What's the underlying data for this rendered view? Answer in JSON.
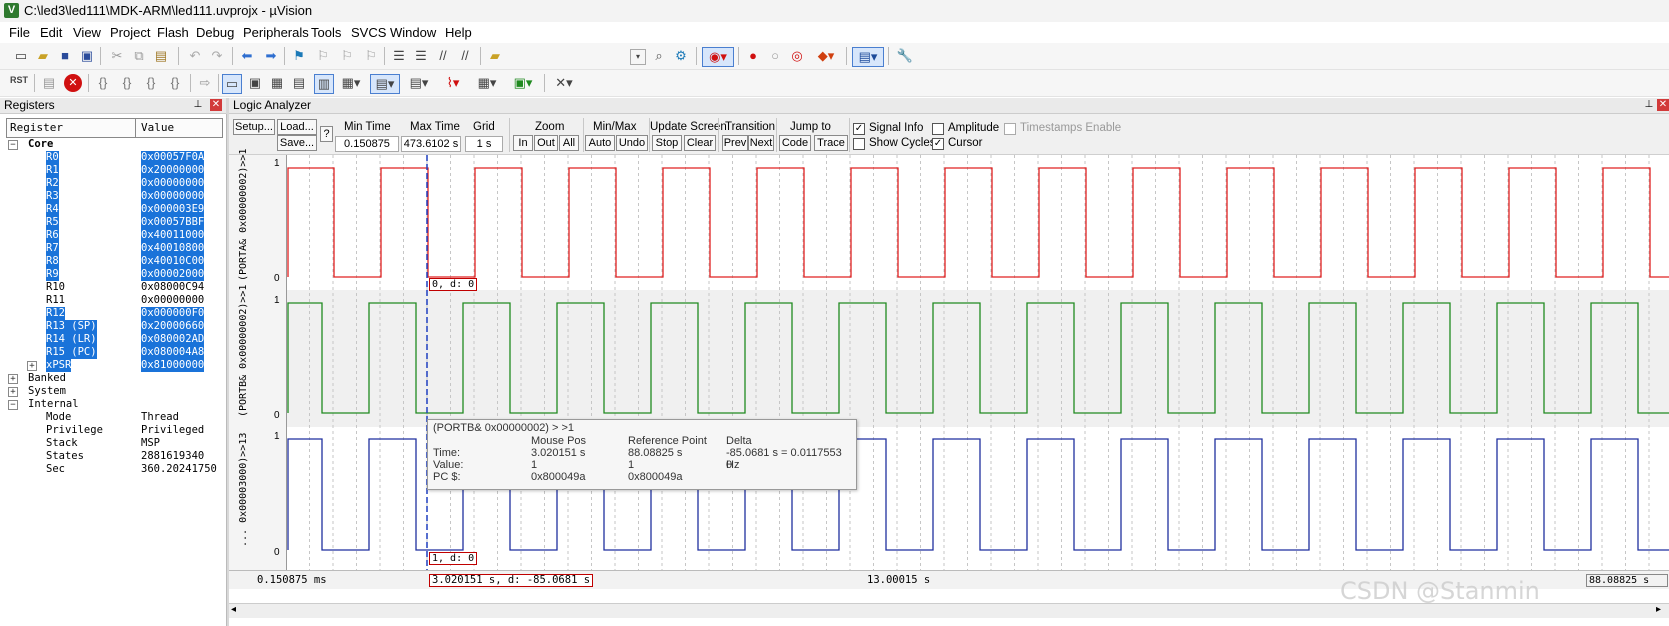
{
  "window": {
    "title": "C:\\led3\\led111\\MDK-ARM\\led111.uvprojx - µVision",
    "app_icon": "V"
  },
  "menu": [
    "File",
    "Edit",
    "View",
    "Project",
    "Flash",
    "Debug",
    "Peripherals",
    "Tools",
    "SVCS",
    "Window",
    "Help"
  ],
  "toolbar2_label": "RST",
  "registers": {
    "title": "Registers",
    "col_register": "Register",
    "col_value": "Value",
    "core_label": "Core",
    "core": [
      {
        "name": "R0",
        "value": "0x00057F0A"
      },
      {
        "name": "R1",
        "value": "0x20000000"
      },
      {
        "name": "R2",
        "value": "0x00000000"
      },
      {
        "name": "R3",
        "value": "0x00000000"
      },
      {
        "name": "R4",
        "value": "0x000003E9"
      },
      {
        "name": "R5",
        "value": "0x00057BBF"
      },
      {
        "name": "R6",
        "value": "0x40011000"
      },
      {
        "name": "R7",
        "value": "0x40010800"
      },
      {
        "name": "R8",
        "value": "0x40010C00"
      },
      {
        "name": "R9",
        "value": "0x00002000"
      },
      {
        "name": "R10",
        "value": "0x08000C94"
      },
      {
        "name": "R11",
        "value": "0x00000000"
      },
      {
        "name": "R12",
        "value": "0x000000F0"
      },
      {
        "name": "R13 (SP)",
        "value": "0x20000660"
      },
      {
        "name": "R14 (LR)",
        "value": "0x080002AD"
      },
      {
        "name": "R15 (PC)",
        "value": "0x080004A8"
      },
      {
        "name": "xPSR",
        "value": "0x81000000"
      }
    ],
    "groups": [
      "Banked",
      "System",
      "Internal"
    ],
    "internal": [
      {
        "name": "Mode",
        "value": "Thread"
      },
      {
        "name": "Privilege",
        "value": "Privileged"
      },
      {
        "name": "Stack",
        "value": "MSP"
      },
      {
        "name": "States",
        "value": "2881619340"
      },
      {
        "name": "Sec",
        "value": "360.20241750"
      }
    ]
  },
  "logic_analyzer": {
    "title": "Logic Analyzer",
    "setup": "Setup...",
    "load": "Load...",
    "save": "Save...",
    "help": "?",
    "min_time_label": "Min Time",
    "min_time": "0.150875 ms",
    "max_time_label": "Max Time",
    "max_time": "473.6102 s",
    "grid_label": "Grid",
    "grid": "1 s",
    "zoom_label": "Zoom",
    "zoom_in": "In",
    "zoom_out": "Out",
    "zoom_all": "All",
    "minmax_label": "Min/Max",
    "auto": "Auto",
    "undo": "Undo",
    "update_label": "Update Screen",
    "stop": "Stop",
    "clear": "Clear",
    "transition_label": "Transition",
    "prev": "Prev",
    "next": "Next",
    "jump_label": "Jump to",
    "code": "Code",
    "trace": "Trace",
    "signal_info": "Signal Info",
    "show_cycles": "Show Cycles",
    "amplitude": "Amplitude",
    "cursor": "Cursor",
    "timestamps": "Timestamps Enable",
    "options": {
      "signal_info": true,
      "show_cycles": false,
      "amplitude": false,
      "cursor": true,
      "timestamps": false
    },
    "signals": [
      {
        "name": "(PORTA& 0x00000002)>>1",
        "color": "#e02020",
        "cursor_label": "0,  d: 0"
      },
      {
        "name": "(PORTB& 0x00000002)>>1",
        "color": "#208a20",
        "cursor_label": ""
      },
      {
        "name": "... 0x00003000)>>13",
        "color": "#1f2f9f",
        "cursor_label": "1,  d: 0"
      }
    ],
    "y_high": "1",
    "y_low": "0",
    "timeline_left": "0.150875 ms",
    "timeline_mid": "13.00015 s",
    "cursor_time": "3.020151 s,  d: -85.0681 s",
    "timeline_right": "88.08825 s",
    "tooltip": {
      "signal": "(PORTB& 0x00000002) > >1",
      "col_mouse": "Mouse Pos",
      "col_ref": "Reference Point",
      "col_delta": "Delta",
      "rows": [
        {
          "label": "Time:",
          "mouse": "3.020151 s",
          "ref": "88.08825 s",
          "delta": "-85.0681 s = 0.0117553 Hz"
        },
        {
          "label": "Value:",
          "mouse": "1",
          "ref": "1",
          "delta": "0"
        },
        {
          "label": "PC $:",
          "mouse": "0x800049a",
          "ref": "0x800049a",
          "delta": ""
        }
      ]
    }
  },
  "watermark": "CSDN @Stanmin"
}
